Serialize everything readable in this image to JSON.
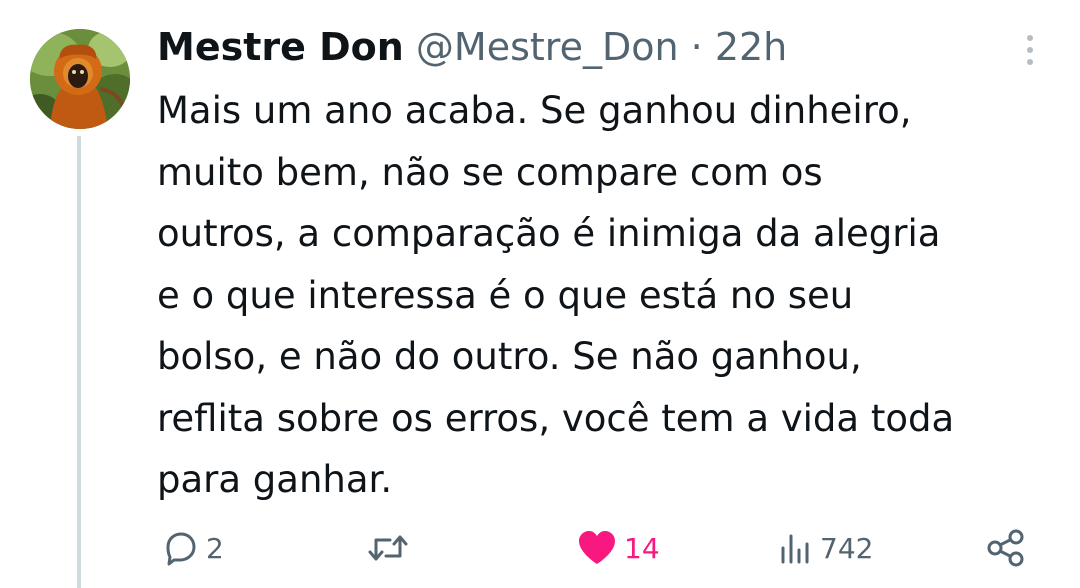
{
  "tweet": {
    "author_name": "Mestre Don",
    "handle": "@Mestre_Don",
    "separator": "·",
    "time": "22h",
    "text_lines": [
      "Mais um ano acaba. Se ganhou dinheiro,",
      "muito bem, não se compare com os",
      "outros, a comparação é inimiga da alegria",
      "e o que interessa é o que está no seu",
      "bolso, e não do outro. Se não ganhou,",
      "reflita sobre os erros, você tem a vida toda",
      "para ganhar."
    ],
    "avatar_icon": "monkey-avatar"
  },
  "actions": {
    "reply_count": "2",
    "retweet_count": "",
    "like_count": "14",
    "views_count": "742",
    "liked": true
  },
  "icons": {
    "more": "more-vertical-icon",
    "reply": "reply-icon",
    "retweet": "retweet-icon",
    "like": "heart-icon",
    "views": "views-icon",
    "share": "share-icon"
  },
  "colors": {
    "text": "#0f1419",
    "secondary": "#536471",
    "like_active": "#f91880",
    "thread_line": "#cfd9de"
  }
}
